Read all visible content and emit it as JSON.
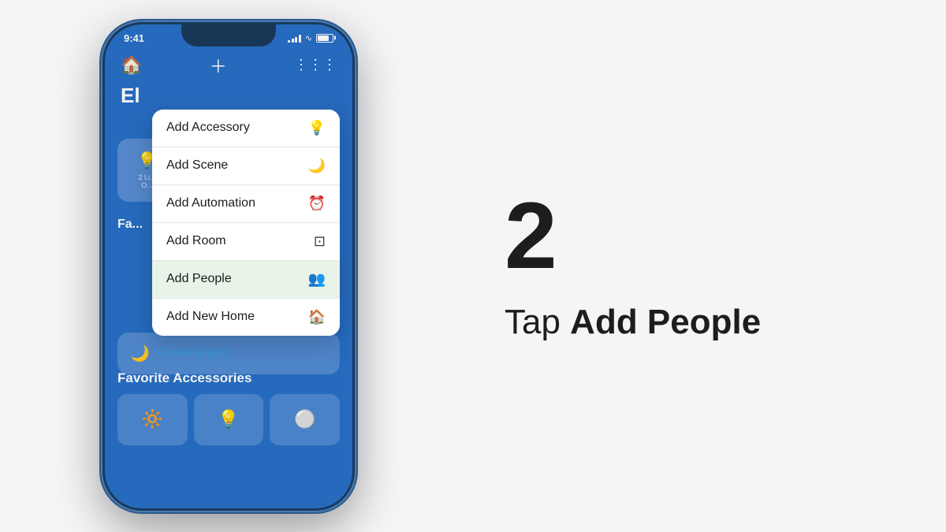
{
  "step": {
    "number": "2",
    "instruction_prefix": "Tap ",
    "instruction_bold": "Add People"
  },
  "phone": {
    "status_time": "9:41",
    "home_title": "El",
    "top_nav": {
      "home_icon": "⌂",
      "add_icon": "+",
      "voice_icon": "≋"
    }
  },
  "menu": {
    "items": [
      {
        "label": "Add Accessory",
        "icon": "💡",
        "highlighted": false
      },
      {
        "label": "Add Scene",
        "icon": "🌙",
        "highlighted": false
      },
      {
        "label": "Add Automation",
        "icon": "🕐",
        "highlighted": false
      },
      {
        "label": "Add Room",
        "icon": "⊡",
        "highlighted": false
      },
      {
        "label": "Add People",
        "icon": "👥",
        "highlighted": true
      },
      {
        "label": "Add New Home",
        "icon": "⌂",
        "highlighted": false
      }
    ]
  },
  "scene": {
    "icon": "🌙",
    "label": "Good Night"
  },
  "favorites": {
    "title": "Favorite Accessories",
    "items": [
      "🔆",
      "💡",
      "⚪"
    ]
  }
}
